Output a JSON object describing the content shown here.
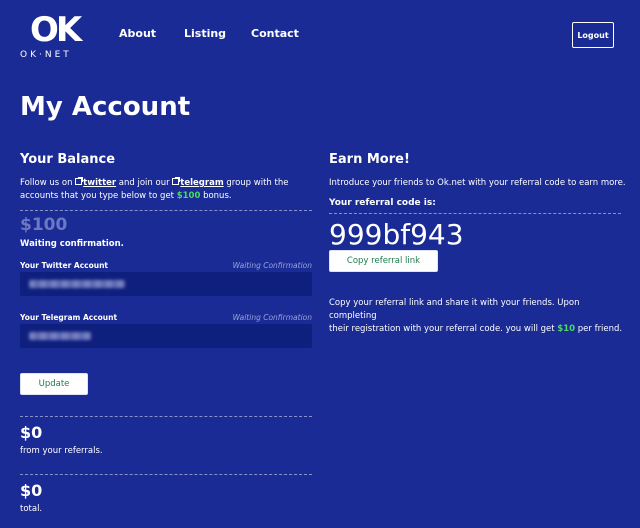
{
  "brand": {
    "logo_mark": "OK",
    "logo_sub": "OK·NET"
  },
  "nav": {
    "about": "About",
    "listing": "Listing",
    "contact": "Contact",
    "logout": "Logout"
  },
  "page": {
    "title": "My Account"
  },
  "balance": {
    "heading": "Your Balance",
    "intro_prefix": "Follow us on ",
    "twitter_link": "twitter",
    "intro_middle": " and join our ",
    "telegram_link": "telegram",
    "intro_after": " group with the",
    "intro_line2_prefix": "accounts that you type below to get ",
    "bonus_amount": "$100",
    "intro_line2_suffix": " bonus.",
    "pending_amount": "$100",
    "pending_status": "Waiting confirmation.",
    "twitter_field": {
      "label": "Your Twitter Account",
      "status": "Waiting Confirmation",
      "value": ""
    },
    "telegram_field": {
      "label": "Your Telegram Account",
      "status": "Waiting Confirmation",
      "value": ""
    },
    "update_button": "Update",
    "referral_amount": "$0",
    "referral_caption": "from your referrals.",
    "total_amount": "$0",
    "total_caption": "total."
  },
  "earn": {
    "heading": "Earn More!",
    "intro": "Introduce your friends to Ok.net with your referral code to earn more.",
    "code_label": "Your referral code is:",
    "code": "999bf943",
    "copy_button": "Copy referral link",
    "desc_line1": "Copy your referral link and share it with your friends. Upon completing",
    "desc_line2_prefix": "their registration with your referral code. you will get ",
    "reward_amount": "$10",
    "desc_line2_suffix": " per friend."
  },
  "colors": {
    "background": "#1a2b96",
    "accent_green": "#4cd964",
    "input_bg": "#0e1f7e"
  }
}
